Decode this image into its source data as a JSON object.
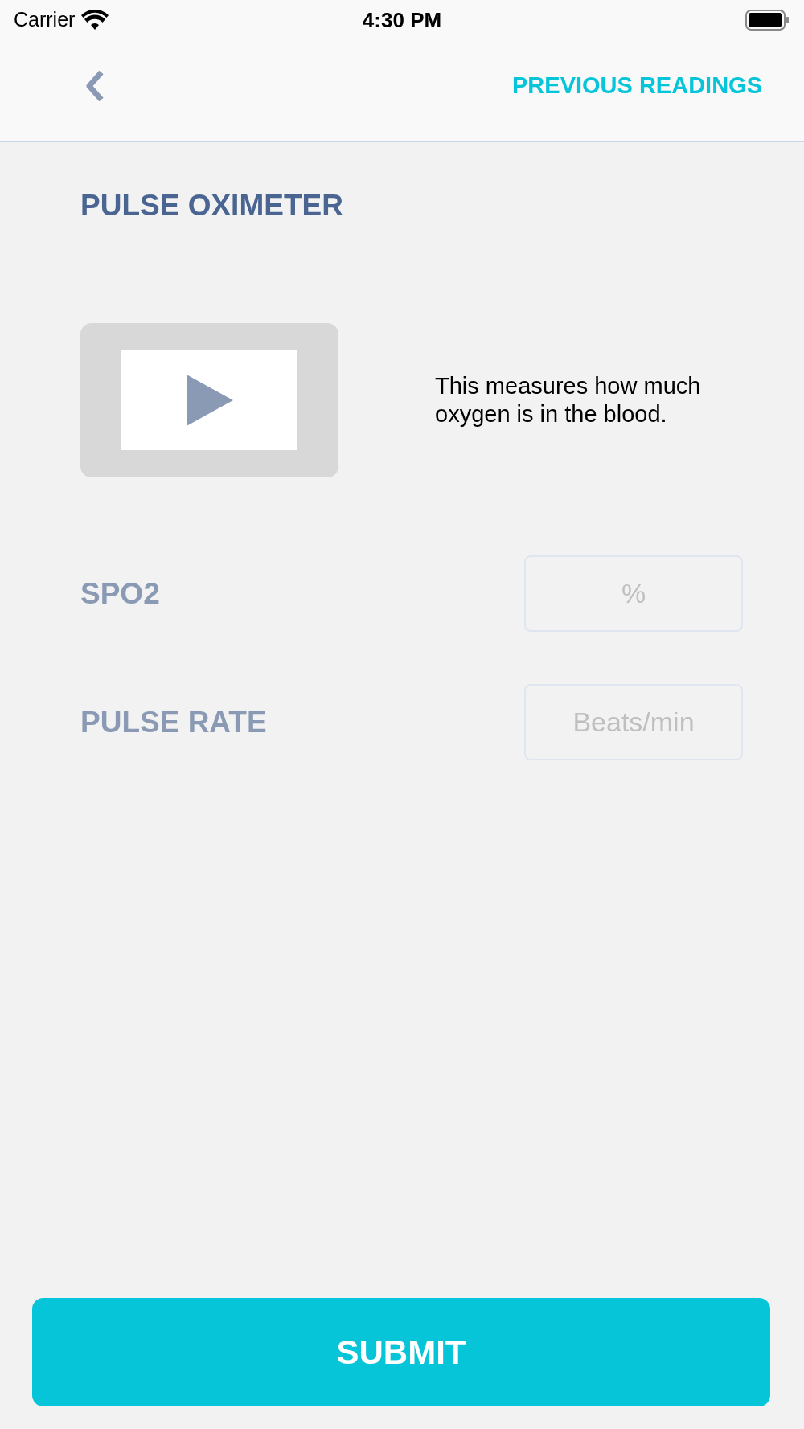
{
  "status_bar": {
    "carrier": "Carrier",
    "time": "4:30 PM"
  },
  "nav_bar": {
    "action": "PREVIOUS READINGS"
  },
  "title": "PULSE OXIMETER",
  "description": "This measures how much oxygen is in the blood.",
  "fields": [
    {
      "label": "SPO2",
      "placeholder": "%"
    },
    {
      "label": "PULSE RATE",
      "placeholder": "Beats/min"
    }
  ],
  "submit": "SUBMIT"
}
